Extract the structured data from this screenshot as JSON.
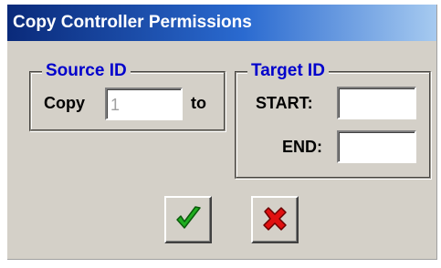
{
  "window": {
    "title": "Copy Controller Permissions"
  },
  "source_group": {
    "caption": "Source ID",
    "copy_label": "Copy",
    "source_value": "1",
    "to_label": "to"
  },
  "target_group": {
    "caption": "Target ID",
    "start_label": "START:",
    "start_value": "",
    "end_label": "END:",
    "end_value": ""
  },
  "buttons": {
    "ok_icon": "green-checkmark-icon",
    "cancel_icon": "red-x-icon"
  },
  "colors": {
    "dialog_bg": "#d4d0c8",
    "title_gradient_start": "#0a2a7a",
    "title_gradient_end": "#a6caf0",
    "caption_color": "#0000cc",
    "ok_green": "#1fae1f",
    "cancel_red": "#e01010"
  }
}
